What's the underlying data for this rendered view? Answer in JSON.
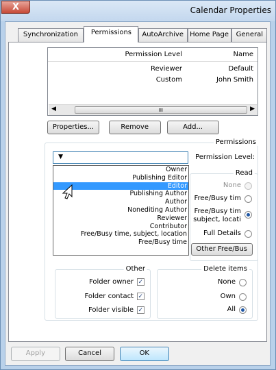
{
  "window": {
    "title": "Calendar Properties",
    "close_label": "X"
  },
  "tabs": [
    "General",
    "Home Page",
    "AutoArchive",
    "Permissions",
    "Synchronization"
  ],
  "active_tab": "Permissions",
  "permissions_list": {
    "columns": [
      "Name",
      "Permission Level"
    ],
    "rows": [
      [
        "Default",
        "Reviewer"
      ],
      [
        "John Smith",
        "Custom"
      ]
    ],
    "scroll_grip": "III"
  },
  "buttons": {
    "add": "Add...",
    "remove": "Remove",
    "properties": "Properties..."
  },
  "permissions_section": {
    "label": "Permissions",
    "level_label": "Permission Level:",
    "level_value": "",
    "dropdown_arrow": "▼",
    "options": [
      "Owner",
      "Publishing Editor",
      "Editor",
      "Publishing Author",
      "Author",
      "Nonediting Author",
      "Reviewer",
      "Contributor",
      "Free/Busy time, subject, location",
      "Free/Busy time"
    ],
    "highlighted_option": "Editor"
  },
  "read": {
    "label": "Read",
    "none": "None",
    "free_busy": "Free/Busy tim",
    "free_busy_detail_1": "Free/Busy tim",
    "free_busy_detail_2": "subject, locati",
    "full_details": "Full Details",
    "other_button": "Other Free/Bus"
  },
  "other": {
    "label": "Other",
    "folder_owner": "Folder owner",
    "folder_contact": "Folder contact",
    "folder_visible": "Folder visible"
  },
  "delete_items": {
    "label": "Delete items",
    "none": "None",
    "own": "Own",
    "all": "All"
  },
  "footer": {
    "ok": "OK",
    "cancel": "Cancel",
    "apply": "Apply"
  },
  "check_mark": "✓"
}
